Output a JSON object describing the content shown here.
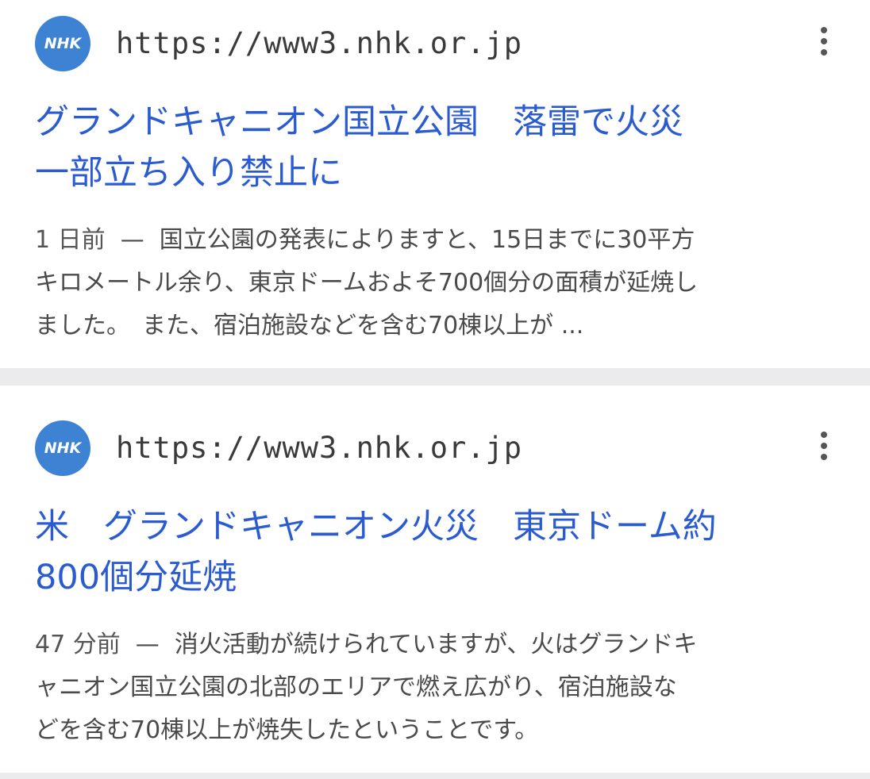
{
  "results": [
    {
      "logo_text": "NHK",
      "url": "https://www3.nhk.or.jp",
      "title_lines": [
        "グランドキャニオン国立公園　落雷で火災",
        "一部立ち入り禁止に"
      ],
      "time": "1 日前",
      "separator": "—",
      "snippet_lines": [
        "国立公園の発表によりますと、15日までに30平方",
        "キロメートル余り、東京ドームおよそ700個分の面積が延焼し",
        "ました。　また、宿泊施設などを含む70棟以上が ..."
      ],
      "more_icon": "more-vertical-icon"
    },
    {
      "logo_text": "NHK",
      "url": "https://www3.nhk.or.jp",
      "title_lines": [
        "米　グランドキャニオン火災　東京ドーム約",
        "800個分延焼"
      ],
      "time": "47 分前",
      "separator": "—",
      "snippet_lines": [
        "消火活動が続けられていますが、火はグランドキ",
        "ャニオン国立公園の北部のエリアで燃え広がり、宿泊施設な",
        "どを含む70棟以上が焼失したということです。"
      ],
      "more_icon": "more-vertical-icon"
    }
  ],
  "colors": {
    "link": "#2b5bd0",
    "logo_bg": "#3d82d3",
    "separator": "#ebebee",
    "text": "#4a4a4a"
  }
}
